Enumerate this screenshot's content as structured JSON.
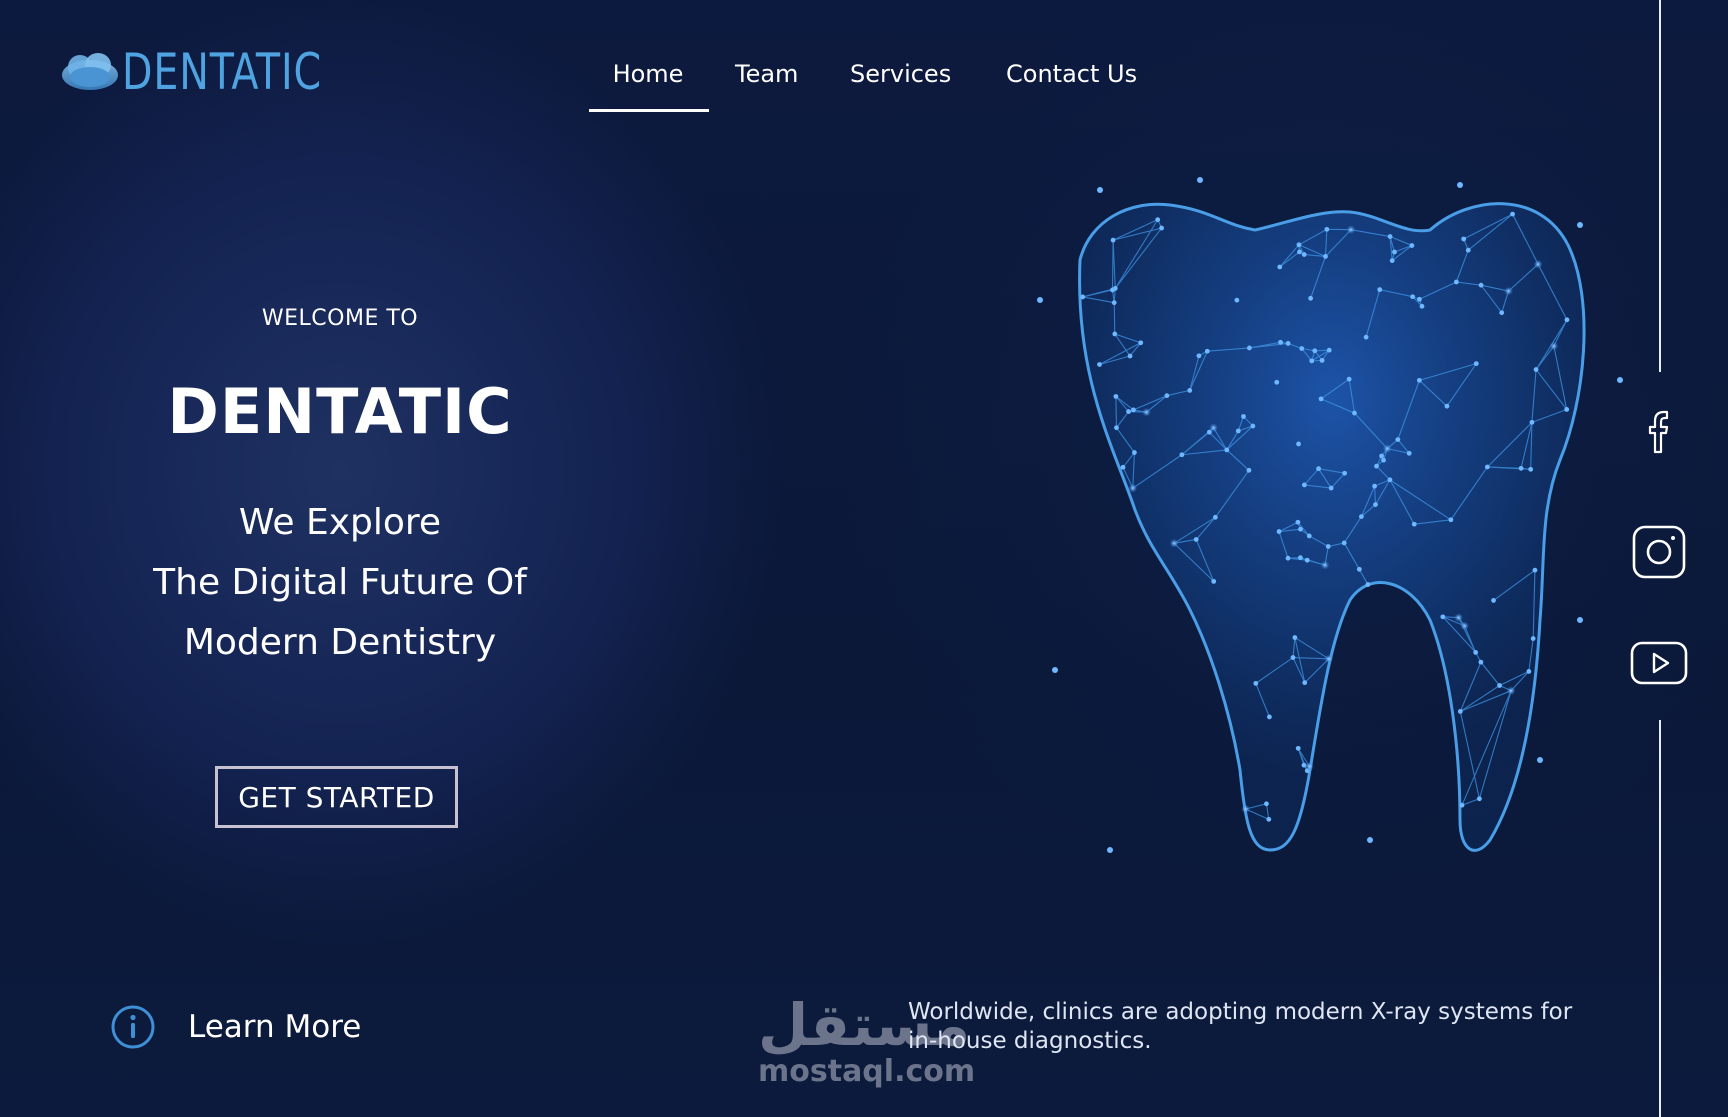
{
  "brand": {
    "logo_text": "DENTATIC",
    "logo_icon": "tooth-cloud-icon",
    "accent_color": "#4ea3e0"
  },
  "nav": {
    "items": [
      {
        "label": "Home",
        "active": true
      },
      {
        "label": "Team",
        "active": false
      },
      {
        "label": "Services",
        "active": false
      },
      {
        "label": "Contact Us",
        "active": false
      }
    ]
  },
  "hero": {
    "welcome": "WELCOME TO",
    "title": "DENTATIC",
    "tagline": [
      "We Explore",
      "The Digital Future Of",
      "Modern Dentistry"
    ],
    "cta_label": "GET STARTED"
  },
  "learn_more": {
    "label": "Learn More",
    "icon": "info-icon"
  },
  "note": {
    "text": "Worldwide, clinics are adopting modern X-ray systems for in-house diagnostics."
  },
  "watermark": {
    "arabic": "مستقل",
    "latin": "mostaql.com"
  },
  "social": [
    {
      "icon": "facebook-icon"
    },
    {
      "icon": "instagram-icon"
    },
    {
      "icon": "youtube-icon"
    }
  ],
  "colors": {
    "background": "#0d1a3f",
    "button_border": "#c7c2d1",
    "tooth_line": "#3a8fe0"
  }
}
